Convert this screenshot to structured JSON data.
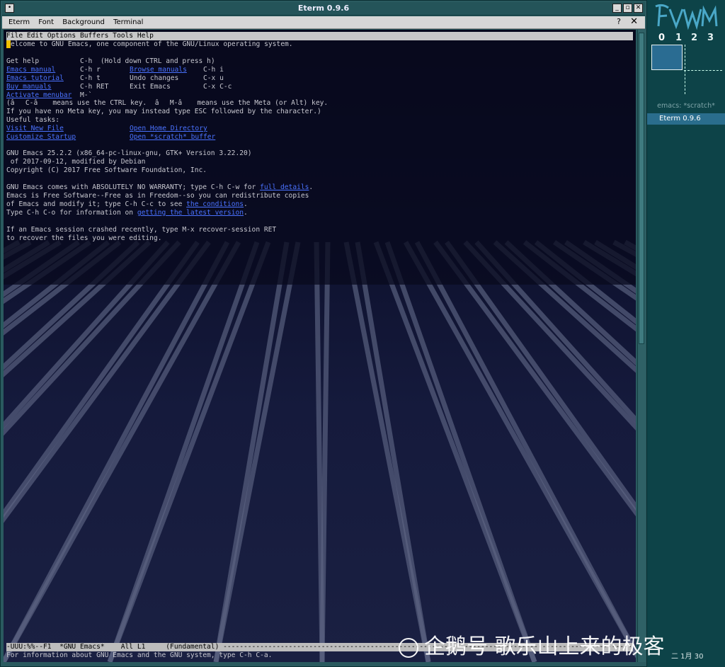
{
  "window": {
    "title": "Eterm 0.9.6",
    "menu": [
      "Eterm",
      "Font",
      "Background",
      "Terminal"
    ],
    "help_glyph": "?",
    "close_glyph": "✕"
  },
  "emacs": {
    "menubar": "File Edit Options Buffers Tools Help",
    "welcome_rest": "elcome to GNU Emacs, one component of the GNU/Linux operating system.",
    "rows": [
      {
        "a": "Get help",
        "b": "C-h  (Hold down CTRL and press h)",
        "c": "",
        "d": "",
        "a_link": false,
        "c_link": false
      },
      {
        "a": "Emacs manual",
        "b": "C-h r",
        "c": "Browse manuals",
        "d": "C-h i",
        "a_link": true,
        "c_link": true
      },
      {
        "a": "Emacs tutorial",
        "b": "C-h t",
        "c": "Undo changes",
        "d": "C-x u",
        "a_link": true,
        "c_link": false
      },
      {
        "a": "Buy manuals",
        "b": "C-h RET",
        "c": "Exit Emacs",
        "d": "C-x C-c",
        "a_link": true,
        "c_link": false
      },
      {
        "a": "Activate menubar",
        "b": "M-`",
        "c": "",
        "d": "",
        "a_link": true,
        "c_link": false
      }
    ],
    "ctrl_note": "(âC-â means use the CTRL key.  âM-â means use the Meta (or Alt) key.",
    "meta_note": "If you have no Meta key, you may instead type ESC followed by the character.)",
    "useful": "Useful tasks:",
    "tasks": [
      {
        "a": "Visit New File",
        "c": "Open Home Directory"
      },
      {
        "a": "Customize Startup",
        "c": "Open *scratch* buffer"
      }
    ],
    "version1": "GNU Emacs 25.2.2 (x86_64-pc-linux-gnu, GTK+ Version 3.22.20)",
    "version2": " of 2017-09-12, modified by Debian",
    "copyright": "Copyright (C) 2017 Free Software Foundation, Inc.",
    "warranty_pre": "GNU Emacs comes with ABSOLUTELY NO WARRANTY; type C-h C-w for ",
    "warranty_link": "full details",
    "warranty_post": ".",
    "free_line": "Emacs is Free Software--Free as in Freedom--so you can redistribute copies",
    "cond_pre": "of Emacs and modify it; type C-h C-c to see ",
    "cond_link": "the conditions",
    "cond_post": ".",
    "info_pre": "Type C-h C-o for information on ",
    "info_link": "getting the latest version",
    "info_post": ".",
    "crash1": "If an Emacs session crashed recently, type M-x recover-session RET",
    "crash2": "to recover the files you were editing.",
    "modeline": "-UUU:%%--F1  *GNU Emacs*    All L1     (Fundamental) ------------------------------------------------------------------------------------------------------------",
    "minibuffer": "For information about GNU Emacs and the GNU system, type C-h C-a."
  },
  "pager": {
    "desks": [
      "0",
      "1",
      "2",
      "3"
    ],
    "tasks": [
      "emacs: *scratch*",
      "Eterm 0.9.6"
    ],
    "clock": "二 1月 30"
  },
  "watermark": "企鹅号 歌乐山上来的极客"
}
